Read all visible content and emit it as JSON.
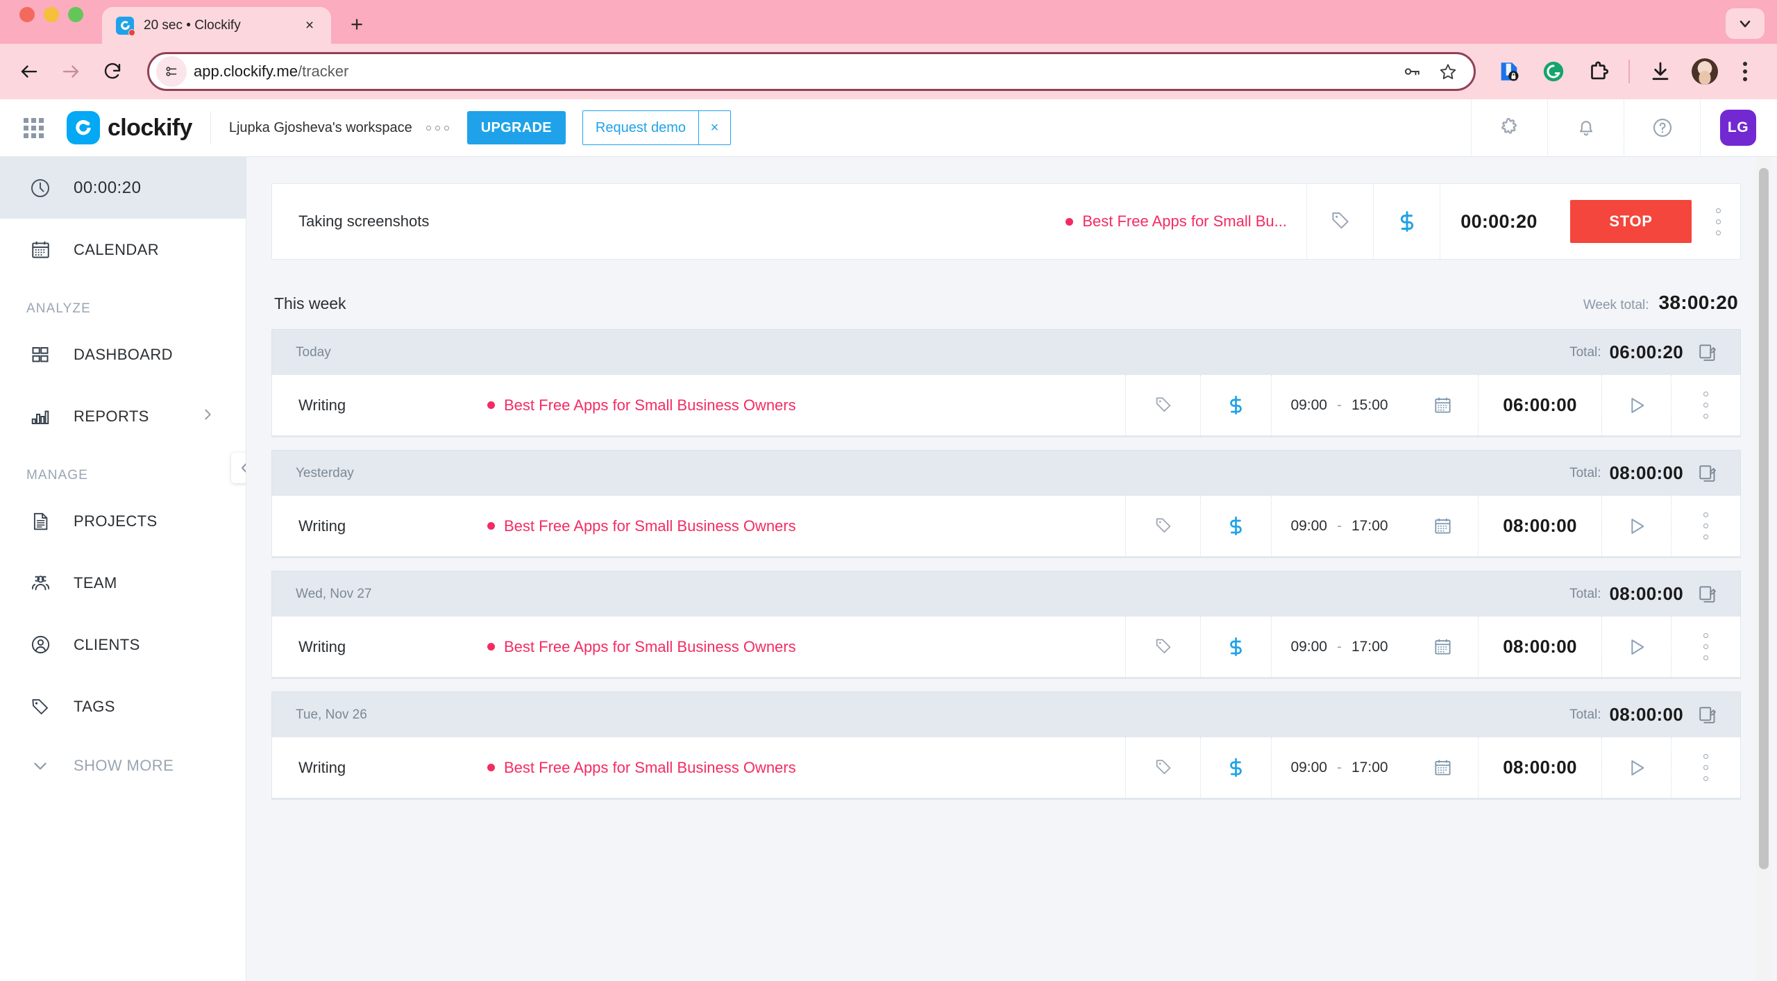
{
  "browser": {
    "tab": {
      "title": "20 sec • Clockify",
      "favicon": "clockify-favicon",
      "close": "×"
    },
    "new_tab": "+",
    "tab_list_chevron": "chevron-down-icon",
    "omnibox": {
      "url_bold": "app.clockify.me",
      "url_path": "/tracker",
      "full_url": "app.clockify.me/tracker",
      "site_info_icon": "site-settings-icon",
      "password_icon": "key-icon",
      "bookmark_icon": "star-icon"
    },
    "extensions": [
      {
        "name": "password-manager-extension-icon",
        "color": "#1a73e8"
      },
      {
        "name": "grammarly-extension-icon",
        "color": "#15a46b"
      },
      {
        "name": "extensions-puzzle-icon",
        "color": "#2b2b2b"
      }
    ],
    "download_icon": "download-icon",
    "profile_icon": "profile-avatar",
    "menu_icon": "three-dot-menu-icon"
  },
  "app": {
    "header": {
      "apps_grid_icon": "apps-grid-icon",
      "brand": "clockify",
      "workspace": "Ljupka Gjosheva's workspace",
      "workspace_more": "workspace-options-icon",
      "upgrade_label": "UPGRADE",
      "demo_label": "Request demo",
      "demo_close": "×",
      "icons": [
        {
          "name": "integrations-puzzle-icon"
        },
        {
          "name": "notifications-bell-icon"
        },
        {
          "name": "help-question-icon"
        }
      ],
      "avatar_initials": "LG"
    },
    "sidebar": {
      "timer": {
        "label": "00:00:20",
        "icon": "clock-icon",
        "active": true
      },
      "calendar": {
        "label": "CALENDAR",
        "icon": "calendar-icon"
      },
      "groups": [
        {
          "title": "ANALYZE",
          "items": [
            {
              "label": "DASHBOARD",
              "icon": "dashboard-grid-icon",
              "chevron": false
            },
            {
              "label": "REPORTS",
              "icon": "reports-bar-chart-icon",
              "chevron": true
            }
          ]
        },
        {
          "title": "MANAGE",
          "items": [
            {
              "label": "PROJECTS",
              "icon": "projects-document-icon",
              "chevron": false
            },
            {
              "label": "TEAM",
              "icon": "team-people-icon",
              "chevron": false
            },
            {
              "label": "CLIENTS",
              "icon": "clients-person-icon",
              "chevron": false
            },
            {
              "label": "TAGS",
              "icon": "tags-label-icon",
              "chevron": false
            }
          ]
        }
      ],
      "show_more": {
        "label": "SHOW MORE",
        "icon": "chevron-down-icon"
      },
      "collapse_button": "collapse-sidebar-icon"
    },
    "tracker": {
      "active_entry": {
        "description": "Taking screenshots",
        "project": "Best Free Apps for Small Bu...",
        "project_color": "#f42b62",
        "tag_icon": "tag-icon",
        "billable_icon": "dollar-icon",
        "duration": "00:00:20",
        "stop_label": "STOP",
        "more_icon": "more-options-icon"
      },
      "week": {
        "title": "This week",
        "total_label": "Week total:",
        "total_value": "38:00:20"
      },
      "days": [
        {
          "name": "Today",
          "total_label": "Total:",
          "total_value": "06:00:20",
          "copy_icon": "duplicate-day-icon",
          "entries": [
            {
              "description": "Writing",
              "project": "Best Free Apps for Small Business Owners",
              "project_color": "#f42b62",
              "tag_icon": "tag-icon",
              "billable_icon": "dollar-icon",
              "start": "09:00",
              "dash": "-",
              "end": "15:00",
              "calendar_icon": "calendar-icon",
              "duration": "06:00:00",
              "play_icon": "play-icon",
              "more_icon": "more-options-icon"
            }
          ]
        },
        {
          "name": "Yesterday",
          "total_label": "Total:",
          "total_value": "08:00:00",
          "copy_icon": "duplicate-day-icon",
          "entries": [
            {
              "description": "Writing",
              "project": "Best Free Apps for Small Business Owners",
              "project_color": "#f42b62",
              "tag_icon": "tag-icon",
              "billable_icon": "dollar-icon",
              "start": "09:00",
              "dash": "-",
              "end": "17:00",
              "calendar_icon": "calendar-icon",
              "duration": "08:00:00",
              "play_icon": "play-icon",
              "more_icon": "more-options-icon"
            }
          ]
        },
        {
          "name": "Wed, Nov 27",
          "total_label": "Total:",
          "total_value": "08:00:00",
          "copy_icon": "duplicate-day-icon",
          "entries": [
            {
              "description": "Writing",
              "project": "Best Free Apps for Small Business Owners",
              "project_color": "#f42b62",
              "tag_icon": "tag-icon",
              "billable_icon": "dollar-icon",
              "start": "09:00",
              "dash": "-",
              "end": "17:00",
              "calendar_icon": "calendar-icon",
              "duration": "08:00:00",
              "play_icon": "play-icon",
              "more_icon": "more-options-icon"
            }
          ]
        },
        {
          "name": "Tue, Nov 26",
          "total_label": "Total:",
          "total_value": "08:00:00",
          "copy_icon": "duplicate-day-icon",
          "entries": [
            {
              "description": "Writing",
              "project": "Best Free Apps for Small Business Owners",
              "project_color": "#f42b62",
              "tag_icon": "tag-icon",
              "billable_icon": "dollar-icon",
              "start": "09:00",
              "dash": "-",
              "end": "17:00",
              "calendar_icon": "calendar-icon",
              "duration": "08:00:00",
              "play_icon": "play-icon",
              "more_icon": "more-options-icon"
            }
          ]
        }
      ]
    }
  },
  "colors": {
    "brand_blue": "#03a9f4",
    "project_pink": "#f42b62",
    "stop_red": "#f4463c",
    "avatar_purple": "#7229d1",
    "chrome_pink": "#fbacbe",
    "chrome_pink_light": "#fcd7de"
  }
}
